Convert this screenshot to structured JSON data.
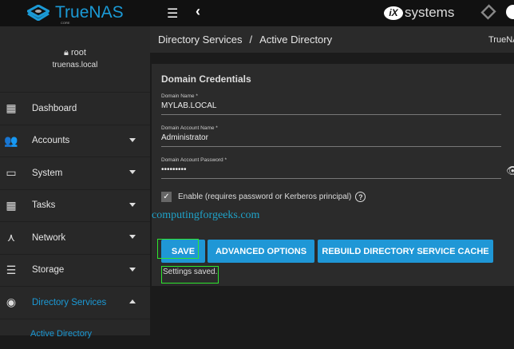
{
  "header": {
    "brand": "TrueNAS",
    "brand_sub": "CORE",
    "vendor": "systems",
    "vendor_mark": "iX"
  },
  "user": {
    "name": "root",
    "host": "truenas.local"
  },
  "sidebar": {
    "items": [
      {
        "label": "Dashboard",
        "icon": "dashboard-icon",
        "glyph": "▦"
      },
      {
        "label": "Accounts",
        "icon": "accounts-icon",
        "glyph": "👥"
      },
      {
        "label": "System",
        "icon": "system-icon",
        "glyph": "▭"
      },
      {
        "label": "Tasks",
        "icon": "calendar-icon",
        "glyph": "▦"
      },
      {
        "label": "Network",
        "icon": "network-icon",
        "glyph": "⋏"
      },
      {
        "label": "Storage",
        "icon": "storage-icon",
        "glyph": "☰"
      },
      {
        "label": "Directory Services",
        "icon": "directory-services-icon",
        "glyph": "◉"
      }
    ],
    "sub_item": "Active Directory"
  },
  "breadcrumb": {
    "parent": "Directory Services",
    "sep": "/",
    "current": "Active Directory",
    "right": "TrueNAS"
  },
  "form": {
    "title": "Domain Credentials",
    "domain_name": {
      "label": "Domain Name *",
      "value": "MYLAB.LOCAL"
    },
    "account_name": {
      "label": "Domain Account Name *",
      "value": "Administrator"
    },
    "password": {
      "label": "Domain Account Password *",
      "value": "•••••••••"
    },
    "enable": {
      "label": "Enable (requires password or Kerberos principal)",
      "checked": true
    }
  },
  "watermark": "computingforgeeks.com",
  "buttons": {
    "save": "SAVE",
    "advanced": "ADVANCED OPTIONS",
    "rebuild": "REBUILD DIRECTORY SERVICE CACHE"
  },
  "status": "Settings saved.",
  "colors": {
    "accent": "#1f97d6",
    "highlight": "#2ee62e"
  }
}
